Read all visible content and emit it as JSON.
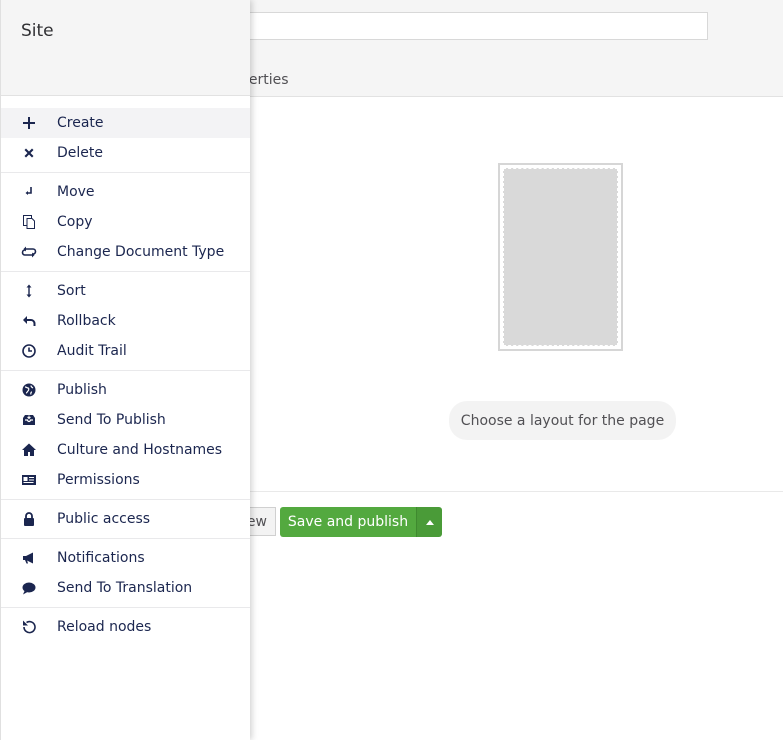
{
  "editor": {
    "tab_partial": "perties",
    "layout_hint": "Choose a layout for the page",
    "preview_partial": "ew",
    "save_publish_label": "Save and publish"
  },
  "panel": {
    "title": "Site",
    "groups": [
      [
        {
          "label": "Create",
          "icon": "plus-icon"
        },
        {
          "label": "Delete",
          "icon": "close-icon"
        }
      ],
      [
        {
          "label": "Move",
          "icon": "move-icon"
        },
        {
          "label": "Copy",
          "icon": "copy-icon"
        },
        {
          "label": "Change Document Type",
          "icon": "swap-icon"
        }
      ],
      [
        {
          "label": "Sort",
          "icon": "sort-icon"
        },
        {
          "label": "Rollback",
          "icon": "undo-icon"
        },
        {
          "label": "Audit Trail",
          "icon": "clock-icon"
        }
      ],
      [
        {
          "label": "Publish",
          "icon": "globe-icon"
        },
        {
          "label": "Send To Publish",
          "icon": "inbox-icon"
        },
        {
          "label": "Culture and Hostnames",
          "icon": "home-icon"
        },
        {
          "label": "Permissions",
          "icon": "id-card-icon"
        }
      ],
      [
        {
          "label": "Public access",
          "icon": "lock-icon"
        }
      ],
      [
        {
          "label": "Notifications",
          "icon": "megaphone-icon"
        },
        {
          "label": "Send To Translation",
          "icon": "chat-icon"
        }
      ],
      [
        {
          "label": "Reload nodes",
          "icon": "reload-icon"
        }
      ]
    ]
  },
  "colors": {
    "primary_text": "#1b264f",
    "publish_green": "#53a93f",
    "hover_row": "#f3f3f5"
  }
}
